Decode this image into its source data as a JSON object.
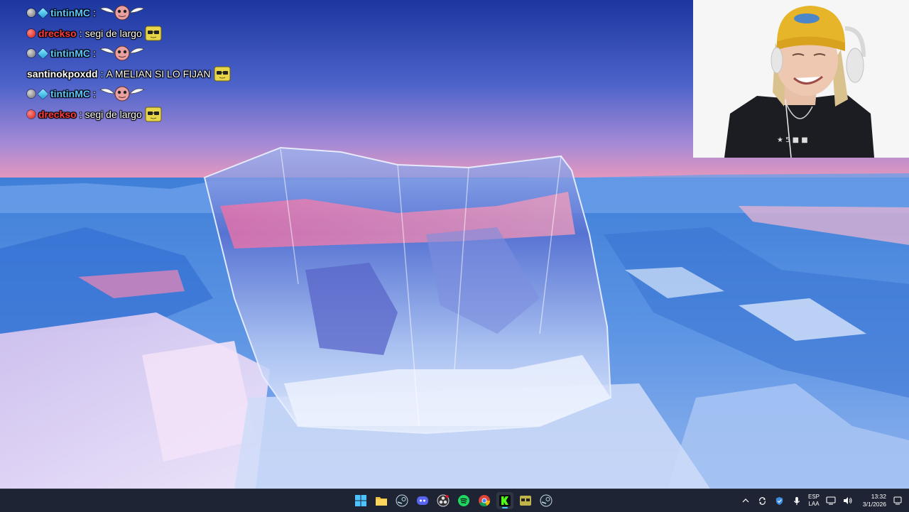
{
  "chat": {
    "messages": [
      {
        "badges": [
          "grey",
          "cube"
        ],
        "user": "tintinMC",
        "user_color": "blue",
        "text": "",
        "emote": "wings-emote"
      },
      {
        "badges": [
          "red"
        ],
        "user": "drecksо",
        "user_color": "red",
        "text": "segi de largo",
        "emote": "cool-emote"
      },
      {
        "badges": [
          "grey",
          "cube"
        ],
        "user": "tintinMC",
        "user_color": "blue",
        "text": "",
        "emote": "wings-emote"
      },
      {
        "badges": [],
        "user": "santinokpoxdd",
        "user_color": "white",
        "text": "A MELIAN SI LO FIJAN",
        "emote": "cool-emote"
      },
      {
        "badges": [
          "grey",
          "cube"
        ],
        "user": "tintinMC",
        "user_color": "blue",
        "text": "",
        "emote": "wings-emote"
      },
      {
        "badges": [
          "red"
        ],
        "user": "drecksо",
        "user_color": "red",
        "text": "segi de largo",
        "emote": "cool-emote"
      }
    ]
  },
  "taskbar": {
    "apps": [
      {
        "name": "start-button",
        "icon": "windows-icon",
        "active": false
      },
      {
        "name": "file-explorer",
        "icon": "folder-icon",
        "active": false
      },
      {
        "name": "steam-1",
        "icon": "steam-icon",
        "active": false
      },
      {
        "name": "discord",
        "icon": "discord-icon",
        "active": false
      },
      {
        "name": "obs",
        "icon": "obs-icon",
        "active": false
      },
      {
        "name": "spotify",
        "icon": "spotify-icon",
        "active": false
      },
      {
        "name": "chrome",
        "icon": "chrome-icon",
        "active": false
      },
      {
        "name": "kick",
        "icon": "kick-icon",
        "active": true
      },
      {
        "name": "sunglasses-app",
        "icon": "glasses-icon",
        "active": false
      },
      {
        "name": "steam-2",
        "icon": "steam-icon",
        "active": false
      }
    ],
    "tray": {
      "language_top": "ESP",
      "language_bottom": "LAA",
      "time": "13:32",
      "date": "3/1/2026"
    }
  },
  "colors": {
    "taskbar_bg": "#1e2433",
    "username_blue": "#5ec8ff",
    "username_red": "#ff3b3b"
  }
}
